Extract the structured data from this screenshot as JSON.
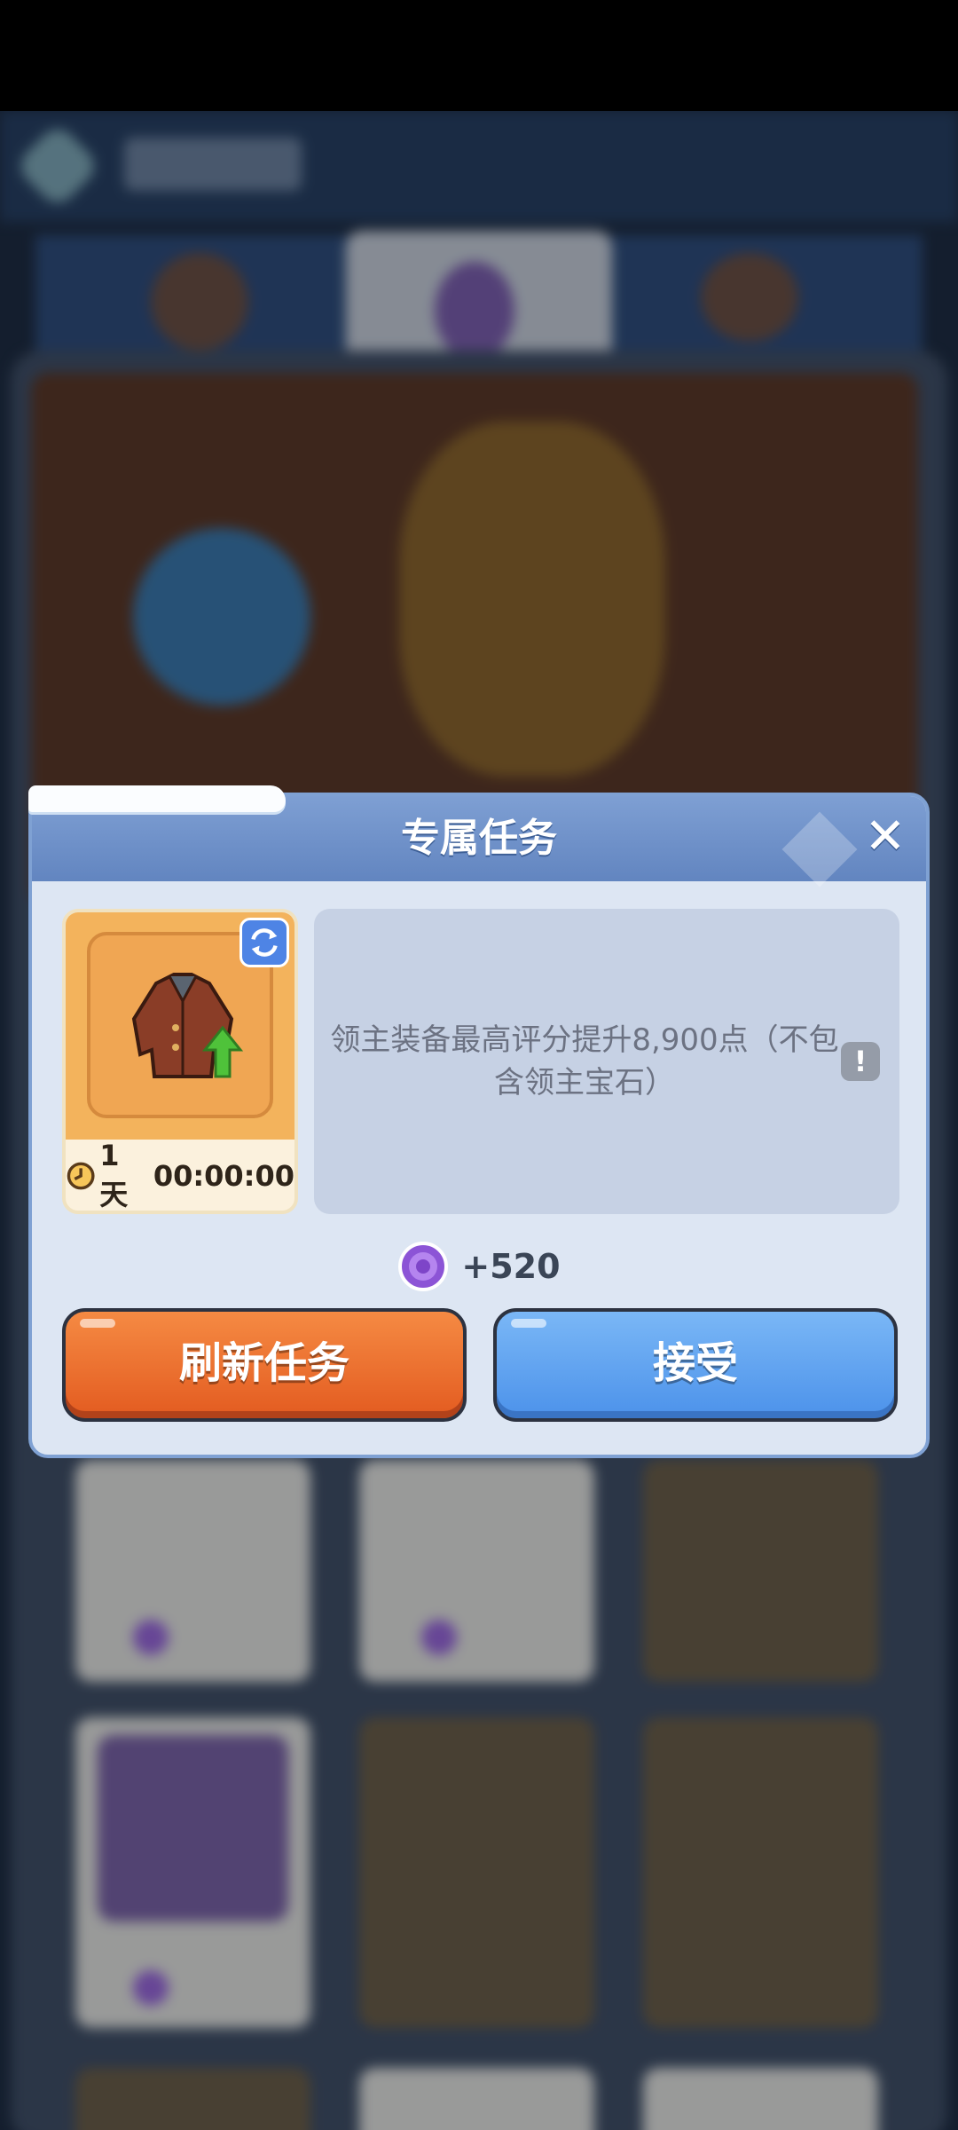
{
  "dialog": {
    "title": "专属任务",
    "close_symbol": "✕",
    "task": {
      "timer_days": "1天",
      "timer_time": "00:00:00",
      "description": "领主装备最高评分提升8,900点（不包含领主宝石）",
      "info_symbol": "!",
      "item_icon": "jacket-icon",
      "refresh_icon": "refresh-icon"
    },
    "reward": {
      "icon": "purple-gem-icon",
      "amount": "+520"
    },
    "buttons": {
      "refresh_label": "刷新任务",
      "accept_label": "接受"
    }
  },
  "colors": {
    "header": "#6b8dc8",
    "dialog_bg": "#dde6f3",
    "refresh_button": "#ea6b2b",
    "accept_button": "#5ca3f0",
    "card_gold": "#f3b35c"
  }
}
